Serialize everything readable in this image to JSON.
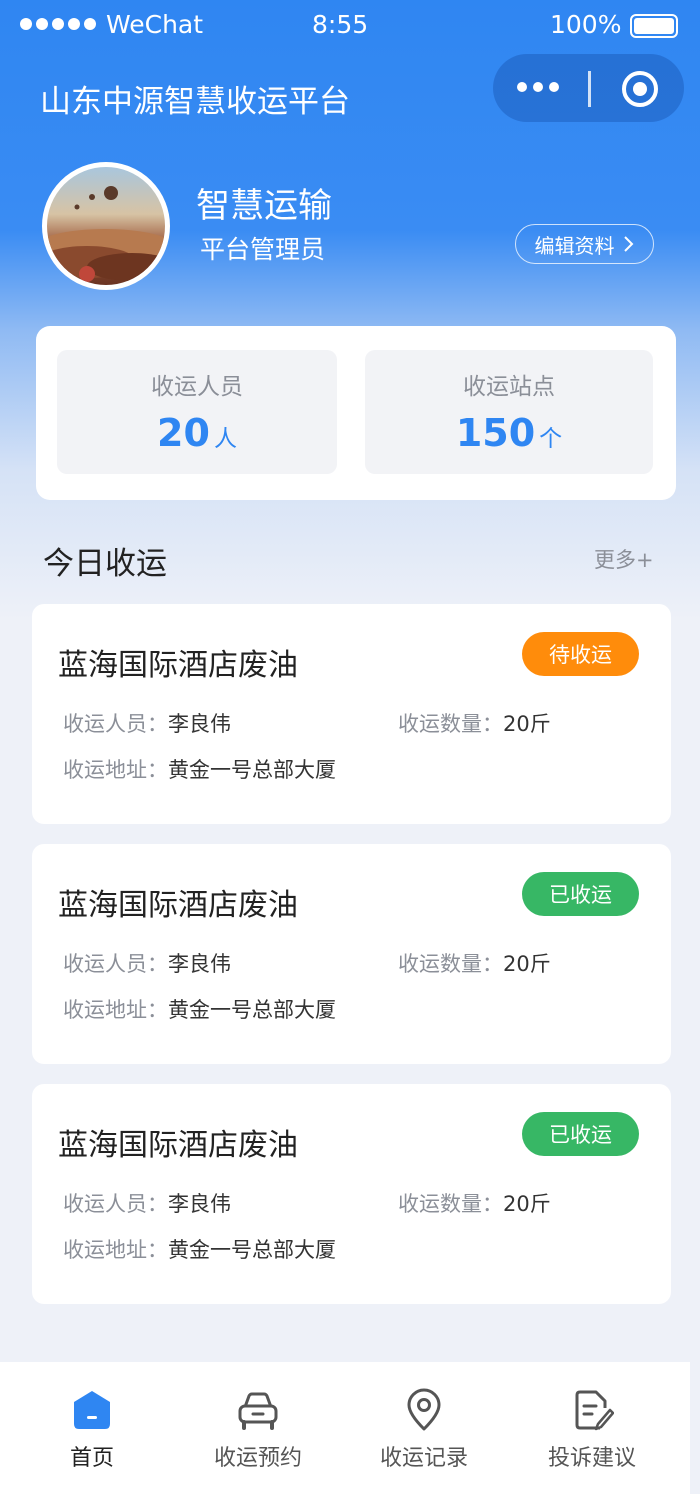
{
  "status_bar": {
    "carrier": "WeChat",
    "time": "8:55",
    "battery": "100%"
  },
  "nav": {
    "title": "山东中源智慧收运平台"
  },
  "profile": {
    "name": "智慧运输",
    "role": "平台管理员",
    "edit_label": "编辑资料"
  },
  "stats": [
    {
      "label": "收运人员",
      "value": "20",
      "unit": "人"
    },
    {
      "label": "收运站点",
      "value": "150",
      "unit": "个"
    }
  ],
  "section": {
    "title": "今日收运",
    "more": "更多+"
  },
  "records": [
    {
      "title": "蓝海国际酒店废油",
      "status": "待收运",
      "person_key": "收运人员：",
      "person": "李良伟",
      "qty_key": "收运数量：",
      "qty": "20斤",
      "addr_key": "收运地址：",
      "addr": "黄金一号总部大厦"
    },
    {
      "title": "蓝海国际酒店废油",
      "status": "已收运",
      "person_key": "收运人员：",
      "person": "李良伟",
      "qty_key": "收运数量：",
      "qty": "20斤",
      "addr_key": "收运地址：",
      "addr": "黄金一号总部大厦"
    },
    {
      "title": "蓝海国际酒店废油",
      "status": "已收运",
      "person_key": "收运人员：",
      "person": "李良伟",
      "qty_key": "收运数量：",
      "qty": "20斤",
      "addr_key": "收运地址：",
      "addr": "黄金一号总部大厦"
    }
  ],
  "tabs": [
    {
      "label": "首页",
      "icon": "home-icon",
      "active": true
    },
    {
      "label": "收运预约",
      "icon": "car-icon",
      "active": false
    },
    {
      "label": "收运记录",
      "icon": "location-pin-icon",
      "active": false
    },
    {
      "label": "投诉建议",
      "icon": "document-edit-icon",
      "active": false
    }
  ],
  "colors": {
    "primary": "#2f86f2",
    "pending": "#ff8c0b",
    "done": "#37b765"
  }
}
